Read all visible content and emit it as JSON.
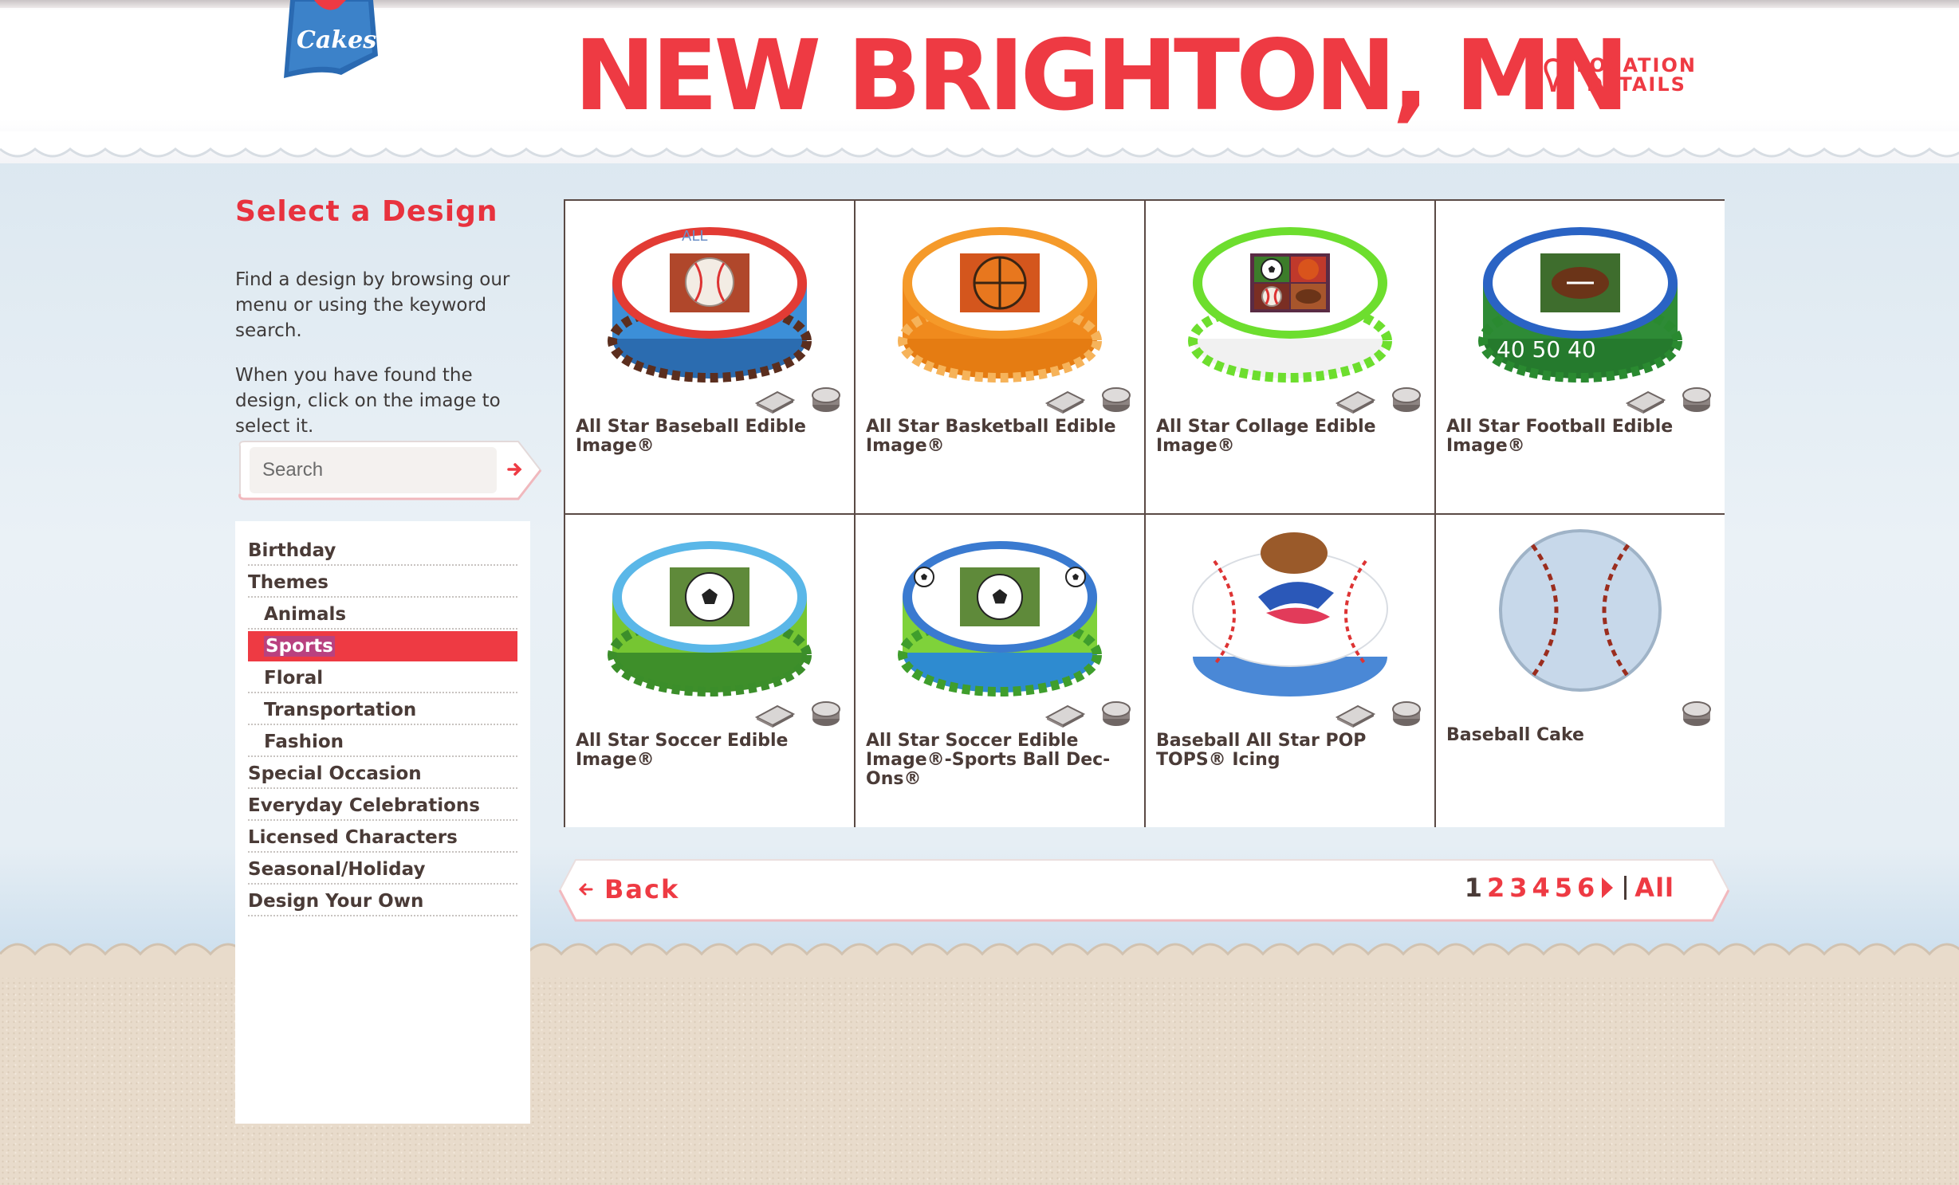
{
  "header": {
    "logo_text": "Cakes",
    "city_title": "NEW BRIGHTON, MN",
    "location_line1": "LOCATION",
    "location_line2": "DETAILS"
  },
  "sidebar": {
    "title": "Select a Design",
    "intro_1": "Find a design by browsing our menu or using the keyword search.",
    "intro_2": "When you have found the design, click on the image to select it.",
    "search_placeholder": "Search",
    "menu": [
      {
        "label": "Birthday",
        "level": 0,
        "active": false
      },
      {
        "label": "Themes",
        "level": 0,
        "active": false
      },
      {
        "label": "Animals",
        "level": 1,
        "active": false
      },
      {
        "label": "Sports",
        "level": 1,
        "active": true
      },
      {
        "label": "Floral",
        "level": 1,
        "active": false
      },
      {
        "label": "Transportation",
        "level": 1,
        "active": false
      },
      {
        "label": "Fashion",
        "level": 1,
        "active": false
      },
      {
        "label": "Special Occasion",
        "level": 0,
        "active": false
      },
      {
        "label": "Everyday Celebrations",
        "level": 0,
        "active": false
      },
      {
        "label": "Licensed Characters",
        "level": 0,
        "active": false
      },
      {
        "label": "Seasonal/Holiday",
        "level": 0,
        "active": false
      },
      {
        "label": "Design Your Own",
        "level": 0,
        "active": false
      }
    ]
  },
  "products": [
    {
      "name": "All Star Baseball Edible Image®",
      "cake": "baseball-image",
      "sheet": true,
      "round": true
    },
    {
      "name": "All Star Basketball Edible Image®",
      "cake": "basketball-image",
      "sheet": true,
      "round": true
    },
    {
      "name": "All Star Collage Edible Image®",
      "cake": "collage-image",
      "sheet": true,
      "round": true
    },
    {
      "name": "All Star Football Edible Image®",
      "cake": "football-image",
      "sheet": true,
      "round": true
    },
    {
      "name": "All Star Soccer Edible Image®",
      "cake": "soccer-image",
      "sheet": true,
      "round": true
    },
    {
      "name": "All Star Soccer Edible Image®-Sports Ball Dec-Ons®",
      "cake": "soccer-decons",
      "sheet": true,
      "round": true
    },
    {
      "name": "Baseball All Star POP TOPS® Icing",
      "cake": "baseball-poptops",
      "sheet": true,
      "round": true
    },
    {
      "name": "Baseball Cake",
      "cake": "baseball-cake",
      "sheet": false,
      "round": true
    }
  ],
  "pager": {
    "back_label": "Back",
    "pages": [
      "1",
      "2",
      "3",
      "4",
      "5",
      "6"
    ],
    "current_page": "1",
    "all_label": "All"
  },
  "colors": {
    "brand_red": "#ee3a43",
    "text_brown": "#4a3b37",
    "active_highlight": "#b9417f"
  }
}
